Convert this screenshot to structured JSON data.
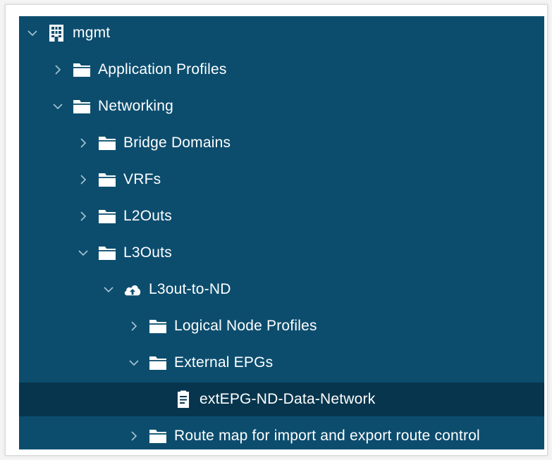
{
  "tree": {
    "items": [
      {
        "label": "mgmt",
        "icon": "tenant-building-icon",
        "expanded": true
      },
      {
        "label": "Application Profiles",
        "icon": "folder-icon",
        "expanded": false
      },
      {
        "label": "Networking",
        "icon": "folder-icon",
        "expanded": true
      },
      {
        "label": "Bridge Domains",
        "icon": "folder-icon",
        "expanded": false
      },
      {
        "label": "VRFs",
        "icon": "folder-icon",
        "expanded": false
      },
      {
        "label": "L2Outs",
        "icon": "folder-icon",
        "expanded": false
      },
      {
        "label": "L3Outs",
        "icon": "folder-icon",
        "expanded": true
      },
      {
        "label": "L3out-to-ND",
        "icon": "cloud-upload-icon",
        "expanded": true
      },
      {
        "label": "Logical Node Profiles",
        "icon": "folder-icon",
        "expanded": false
      },
      {
        "label": "External EPGs",
        "icon": "folder-icon",
        "expanded": true
      },
      {
        "label": "extEPG-ND-Data-Network",
        "icon": "epg-document-icon",
        "selected": true
      },
      {
        "label": "Route map for import and export route control",
        "icon": "folder-icon",
        "expanded": false
      }
    ]
  },
  "colors": {
    "panel_background": "#0c4d6e",
    "selected_row": "#07354d",
    "text": "#ffffff",
    "chevron": "#a9c4d3"
  }
}
